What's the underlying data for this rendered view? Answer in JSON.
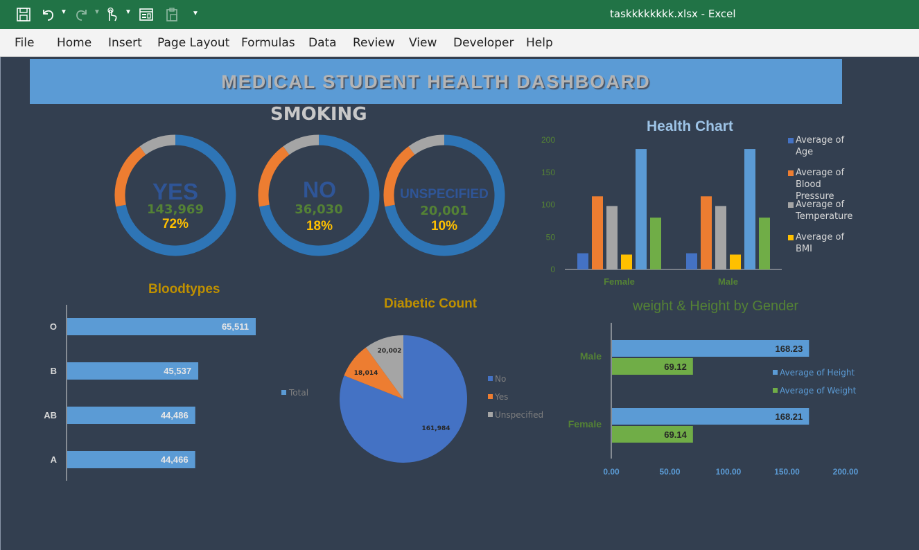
{
  "titlebar": {
    "filename": "taskkkkkkkk.xlsx",
    "separator": " - ",
    "app": "Excel",
    "icons": [
      "save-icon",
      "undo-icon",
      "redo-icon",
      "touch-mode-icon",
      "form-icon",
      "paste-special-icon",
      "customize-toolbar-icon"
    ]
  },
  "menu": [
    "File",
    "Home",
    "Insert",
    "Page Layout",
    "Formulas",
    "Data",
    "Review",
    "View",
    "Developer",
    "Help"
  ],
  "dashboard": {
    "title": "MEDICAL STUDENT HEALTH DASHBOARD",
    "smoking": {
      "title": "SMOKING",
      "donuts": [
        {
          "label": "YES",
          "count": "143,969",
          "percent": "72%",
          "share": 0.72
        },
        {
          "label": "NO",
          "count": "36,030",
          "percent": "18%",
          "share": 0.18
        },
        {
          "label": "UNSPECIFIED",
          "count": "20,001",
          "percent": "10%",
          "share": 0.1
        }
      ]
    },
    "colors": {
      "blue": "#2e75b6",
      "orange": "#ed7d31",
      "gray": "#a5a5a5",
      "yellow": "#ffc000",
      "lightblue": "#5b9bd5",
      "green": "#70ad47",
      "gold": "#bf9000",
      "darkgreen": "#548235"
    }
  },
  "chart_data": [
    {
      "type": "bar",
      "title": "Health Chart",
      "categories": [
        "Female",
        "Male"
      ],
      "series": [
        {
          "name": "Average of Age",
          "values": [
            25,
            25
          ]
        },
        {
          "name": "Average of Blood Pressure",
          "values": [
            113,
            113
          ]
        },
        {
          "name": "Average of Temperature",
          "values": [
            98,
            98
          ]
        },
        {
          "name": "Average of BMI",
          "values": [
            23,
            23
          ]
        },
        {
          "name": "",
          "values": [
            186,
            186
          ]
        },
        {
          "name": "",
          "values": [
            80,
            80
          ]
        }
      ],
      "yticks": [
        "0",
        "50",
        "100",
        "150",
        "200"
      ],
      "ylim": [
        0,
        200
      ],
      "legend": "right"
    },
    {
      "type": "bar",
      "orientation": "horizontal",
      "title": "Bloodtypes",
      "categories": [
        "O",
        "B",
        "AB",
        "A"
      ],
      "values": [
        65511,
        45537,
        44486,
        44466
      ],
      "value_labels": [
        "65,511",
        "45,537",
        "44,486",
        "44,466"
      ]
    },
    {
      "type": "pie",
      "title": "Diabetic Count",
      "categories": [
        "No",
        "Yes",
        "Unspecified"
      ],
      "values": [
        161984,
        18014,
        20002
      ],
      "value_labels": [
        "161,984",
        "18,014",
        "20,002"
      ],
      "legend_left": "Total",
      "legend": "right"
    },
    {
      "type": "bar",
      "orientation": "horizontal",
      "title": "weight & Height by Gender",
      "categories": [
        "Male",
        "Female"
      ],
      "series": [
        {
          "name": "Average of Height",
          "values": [
            168.23,
            168.21
          ],
          "labels": [
            "168.23",
            "168.21"
          ]
        },
        {
          "name": "Average of Weight",
          "values": [
            69.12,
            69.14
          ],
          "labels": [
            "69.12",
            "69.14"
          ]
        }
      ],
      "xticks": [
        "0.00",
        "50.00",
        "100.00",
        "150.00",
        "200.00"
      ],
      "xlim": [
        0,
        200
      ],
      "legend": "right"
    }
  ]
}
